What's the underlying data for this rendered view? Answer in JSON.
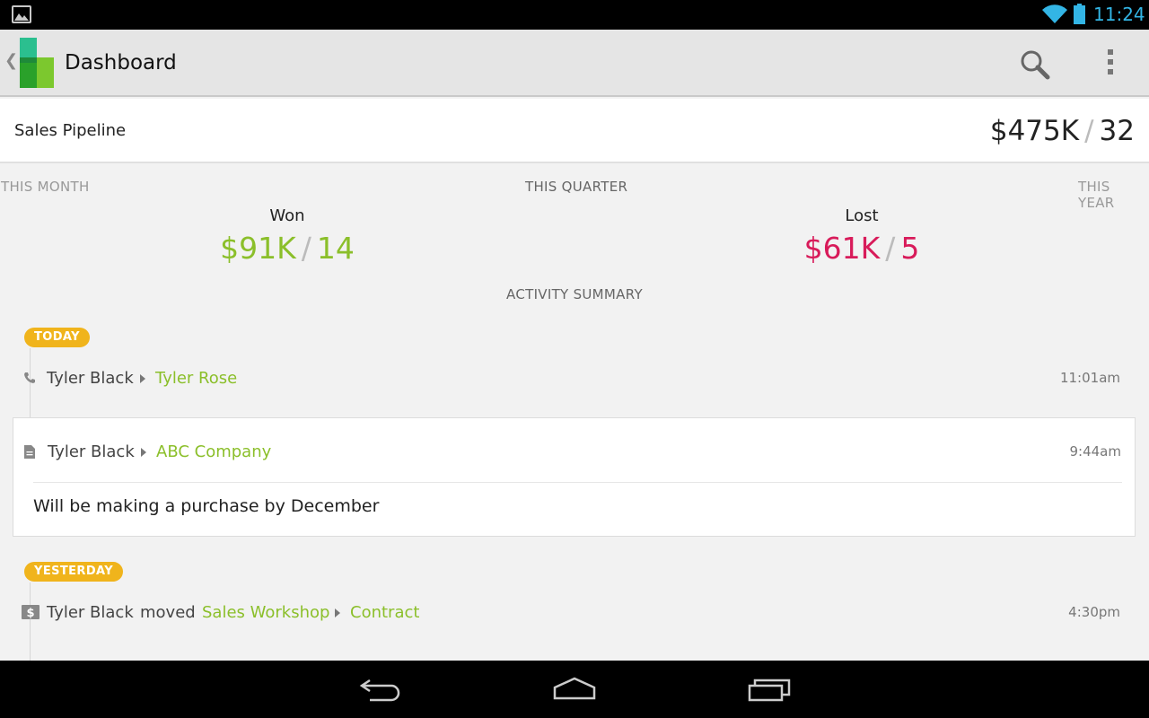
{
  "status_bar": {
    "time": "11:24",
    "icons": [
      "gallery-icon",
      "wifi-icon",
      "battery-icon"
    ],
    "accent": "#33b5e5"
  },
  "action_bar": {
    "title": "Dashboard",
    "icons": [
      "app-logo-icon",
      "search-icon",
      "overflow-menu-icon"
    ]
  },
  "pipeline": {
    "label": "Sales Pipeline",
    "amount": "$475K",
    "count": "32"
  },
  "period_tabs": {
    "month": "THIS MONTH",
    "quarter": "THIS QUARTER",
    "year": "THIS YEAR"
  },
  "won": {
    "label": "Won",
    "amount": "$91K",
    "count": "14",
    "color": "#8bbf2a"
  },
  "lost": {
    "label": "Lost",
    "amount": "$61K",
    "count": "5",
    "color": "#d81b5a"
  },
  "activity_summary": {
    "title": "ACTIVITY SUMMARY",
    "groups": [
      {
        "badge": "TODAY",
        "items": [
          {
            "icon": "phone-icon",
            "actor": "Tyler Black",
            "target": "Tyler Rose",
            "time": "11:01am"
          },
          {
            "icon": "note-icon",
            "actor": "Tyler Black",
            "target": "ABC Company",
            "time": "9:44am",
            "note": "Will be making a purchase by December"
          }
        ]
      },
      {
        "badge": "YESTERDAY",
        "items": [
          {
            "icon": "deal-icon",
            "actor": "Tyler Black",
            "verb": "moved",
            "target": "Sales Workshop",
            "target2": "Contract",
            "time": "4:30pm"
          }
        ]
      }
    ],
    "badge_color": "#f0b41c"
  },
  "nav_bar": {
    "icons": [
      "back-icon",
      "home-icon",
      "recents-icon"
    ]
  }
}
